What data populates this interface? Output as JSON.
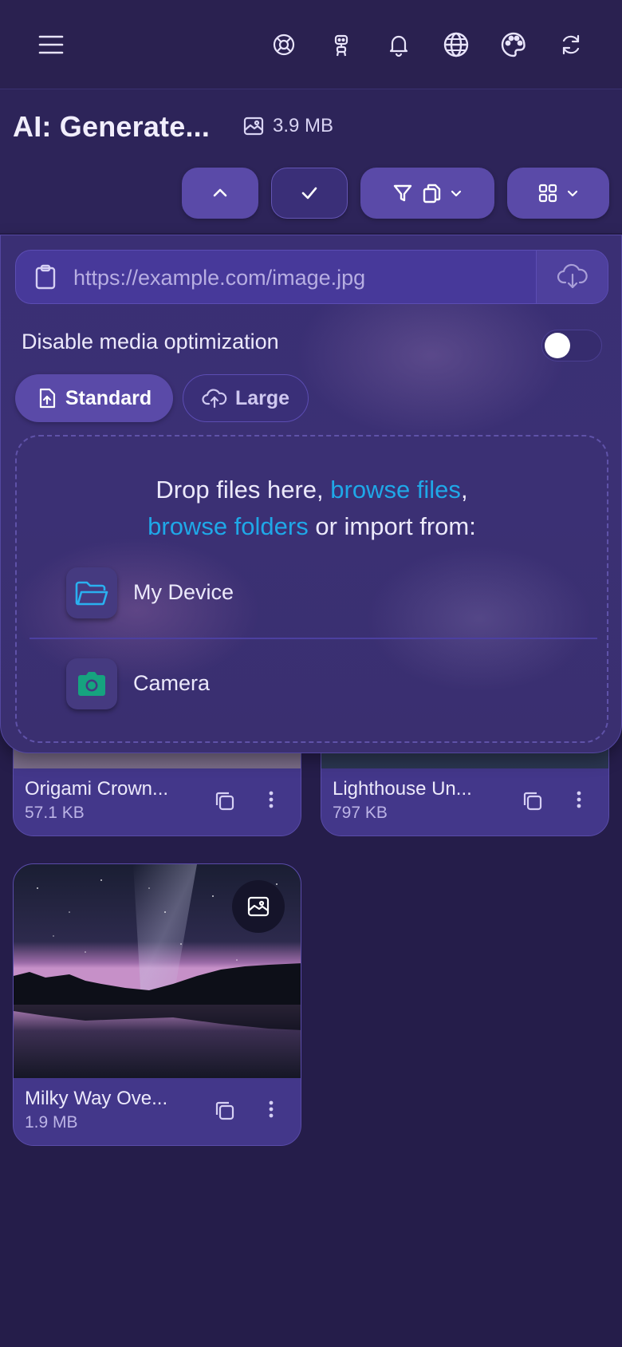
{
  "topbar": {
    "icons": [
      "menu-icon",
      "lifebuoy-icon",
      "robot-icon",
      "bell-icon",
      "globe-icon",
      "palette-icon",
      "refresh-icon"
    ]
  },
  "header": {
    "title": "AI: Generate...",
    "total_size": "3.9 MB"
  },
  "toolbar": {
    "buttons": [
      "chevron-up-icon",
      "check-icon",
      "filter-copy-dropdown",
      "grid-view-dropdown"
    ]
  },
  "upload": {
    "url_placeholder": "https://example.com/image.jpg",
    "option_label": "Disable media optimization",
    "option_enabled": false,
    "modes": [
      "Standard",
      "Large"
    ],
    "active_mode": "Standard",
    "drop_text_1": "Drop files here, ",
    "browse_files": "browse files",
    "comma": ",",
    "browse_folders": "browse folders",
    "drop_text_2": " or import from:",
    "sources": [
      "My Device",
      "Camera"
    ]
  },
  "files": [
    {
      "name": "Origami Crown...",
      "size": "57.1 KB"
    },
    {
      "name": "Lighthouse Un...",
      "size": "797 KB"
    },
    {
      "name": "Milky Way Ove...",
      "size": "1.9 MB"
    }
  ],
  "colors": {
    "background": "#251d4a",
    "accent": "#5a4aa8",
    "link": "#1fa8e8",
    "camera": "#16a37f"
  }
}
